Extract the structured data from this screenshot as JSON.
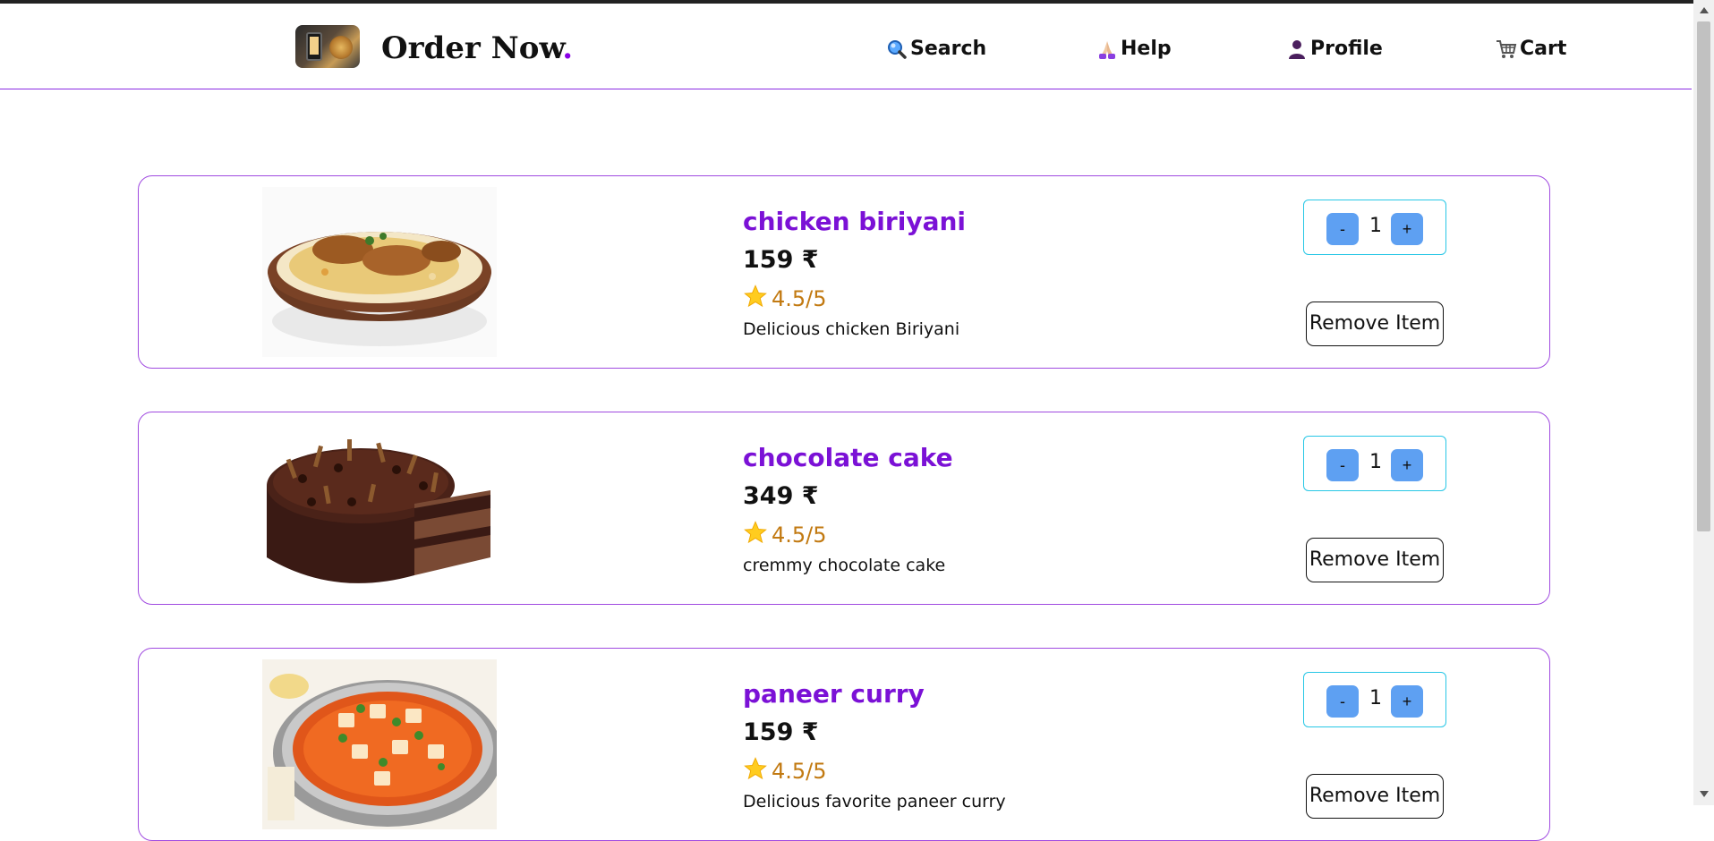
{
  "header": {
    "brand": "Order Now",
    "brand_dot": ".",
    "nav": {
      "search": "Search",
      "help": "Help",
      "profile": "Profile",
      "cart": "Cart"
    }
  },
  "colors": {
    "accent": "#8a00e6",
    "title": "#7b11d6",
    "rating": "#c27a12",
    "qty_button": "#5ea0f2",
    "qty_border": "#28c7e6",
    "card_border": "#a04ae0"
  },
  "items": [
    {
      "name": "chicken biriyani",
      "price": "159 ₹",
      "rating": "4.5/5",
      "description": "Delicious chicken Biriyani",
      "quantity": "1",
      "minus": "-",
      "plus": "+",
      "remove": "Remove Item",
      "image_icon": "biriyani-image"
    },
    {
      "name": "chocolate cake",
      "price": "349 ₹",
      "rating": "4.5/5",
      "description": "cremmy chocolate cake",
      "quantity": "1",
      "minus": "-",
      "plus": "+",
      "remove": "Remove Item",
      "image_icon": "cake-image"
    },
    {
      "name": "paneer curry",
      "price": "159 ₹",
      "rating": "4.5/5",
      "description": "Delicious favorite paneer curry",
      "quantity": "1",
      "minus": "-",
      "plus": "+",
      "remove": "Remove Item",
      "image_icon": "curry-image"
    }
  ]
}
